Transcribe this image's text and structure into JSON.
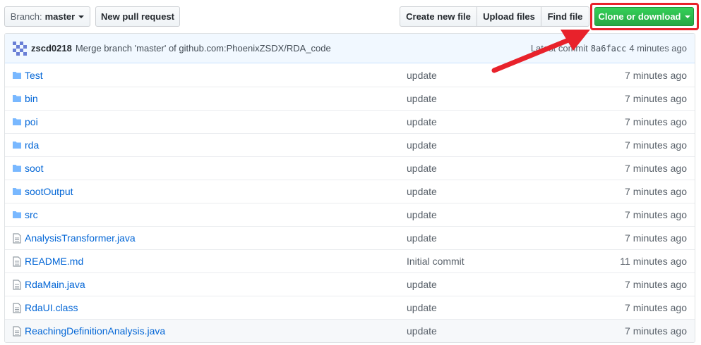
{
  "toolbar": {
    "branch_prefix": "Branch:",
    "branch_name": "master",
    "new_pull_request": "New pull request",
    "create_new_file": "Create new file",
    "upload_files": "Upload files",
    "find_file": "Find file",
    "clone_or_download": "Clone or download"
  },
  "commit": {
    "author": "zscd0218",
    "message": "Merge branch 'master' of github.com:PhoenixZSDX/RDA_code",
    "latest_label": "Latest commit",
    "sha": "8a6facc",
    "age": "4 minutes ago"
  },
  "files": [
    {
      "name": "Test",
      "type": "folder",
      "message": "update",
      "age": "7 minutes ago"
    },
    {
      "name": "bin",
      "type": "folder",
      "message": "update",
      "age": "7 minutes ago"
    },
    {
      "name": "poi",
      "type": "folder",
      "message": "update",
      "age": "7 minutes ago"
    },
    {
      "name": "rda",
      "type": "folder",
      "message": "update",
      "age": "7 minutes ago"
    },
    {
      "name": "soot",
      "type": "folder",
      "message": "update",
      "age": "7 minutes ago"
    },
    {
      "name": "sootOutput",
      "type": "folder",
      "message": "update",
      "age": "7 minutes ago"
    },
    {
      "name": "src",
      "type": "folder",
      "message": "update",
      "age": "7 minutes ago"
    },
    {
      "name": "AnalysisTransformer.java",
      "type": "file",
      "message": "update",
      "age": "7 minutes ago"
    },
    {
      "name": "README.md",
      "type": "file",
      "message": "Initial commit",
      "age": "11 minutes ago"
    },
    {
      "name": "RdaMain.java",
      "type": "file",
      "message": "update",
      "age": "7 minutes ago"
    },
    {
      "name": "RdaUI.class",
      "type": "file",
      "message": "update",
      "age": "7 minutes ago"
    },
    {
      "name": "ReachingDefinitionAnalysis.java",
      "type": "file",
      "message": "update",
      "age": "7 minutes ago"
    }
  ],
  "colors": {
    "link": "#0366d6",
    "clone_button": "#28a745",
    "highlight": "#e8222b",
    "folder_icon": "#79b8ff"
  }
}
